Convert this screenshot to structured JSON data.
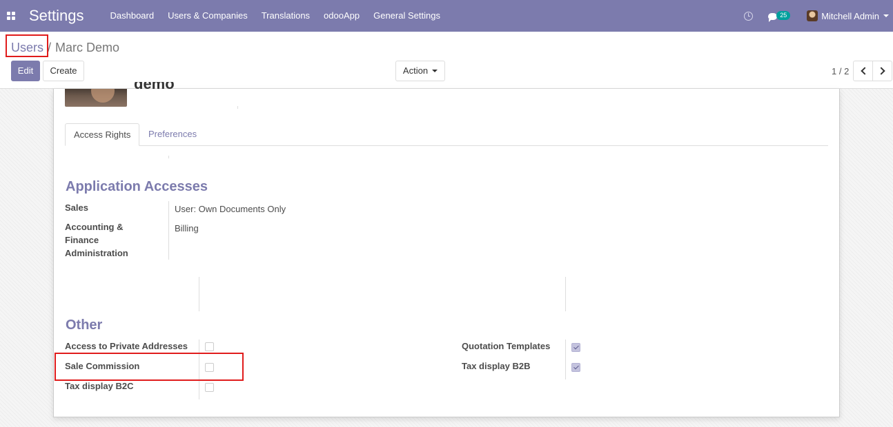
{
  "topbar": {
    "app_title": "Settings",
    "menu": [
      "Dashboard",
      "Users & Companies",
      "Translations",
      "odooApp",
      "General Settings"
    ],
    "chat_count": "25",
    "user_name": "Mitchell Admin"
  },
  "control": {
    "breadcrumb_parent": "Users",
    "breadcrumb_separator": "/",
    "breadcrumb_current": "Marc Demo",
    "edit_label": "Edit",
    "create_label": "Create",
    "action_label": "Action",
    "pager": "1 / 2"
  },
  "form": {
    "name_fragment": "demo",
    "tabs": [
      "Access Rights",
      "Preferences"
    ],
    "application_accesses": {
      "title": "Application Accesses",
      "fields": [
        {
          "label": "Sales",
          "value": "User: Own Documents Only"
        },
        {
          "label_lines": [
            "Accounting &",
            "Finance",
            "Administration"
          ],
          "value": "Billing"
        }
      ]
    },
    "other": {
      "title": "Other",
      "left": [
        {
          "label": "Access to Private Addresses",
          "checked": false
        },
        {
          "label": "Sale Commission",
          "checked": false
        },
        {
          "label": "Tax display B2C",
          "checked": false
        }
      ],
      "right": [
        {
          "label": "Quotation Templates",
          "checked": true
        },
        {
          "label": "Tax display B2B",
          "checked": true
        }
      ]
    }
  },
  "colors": {
    "brand": "#7c7bad",
    "badge": "#00a09d",
    "highlight": "#e01b1b"
  }
}
